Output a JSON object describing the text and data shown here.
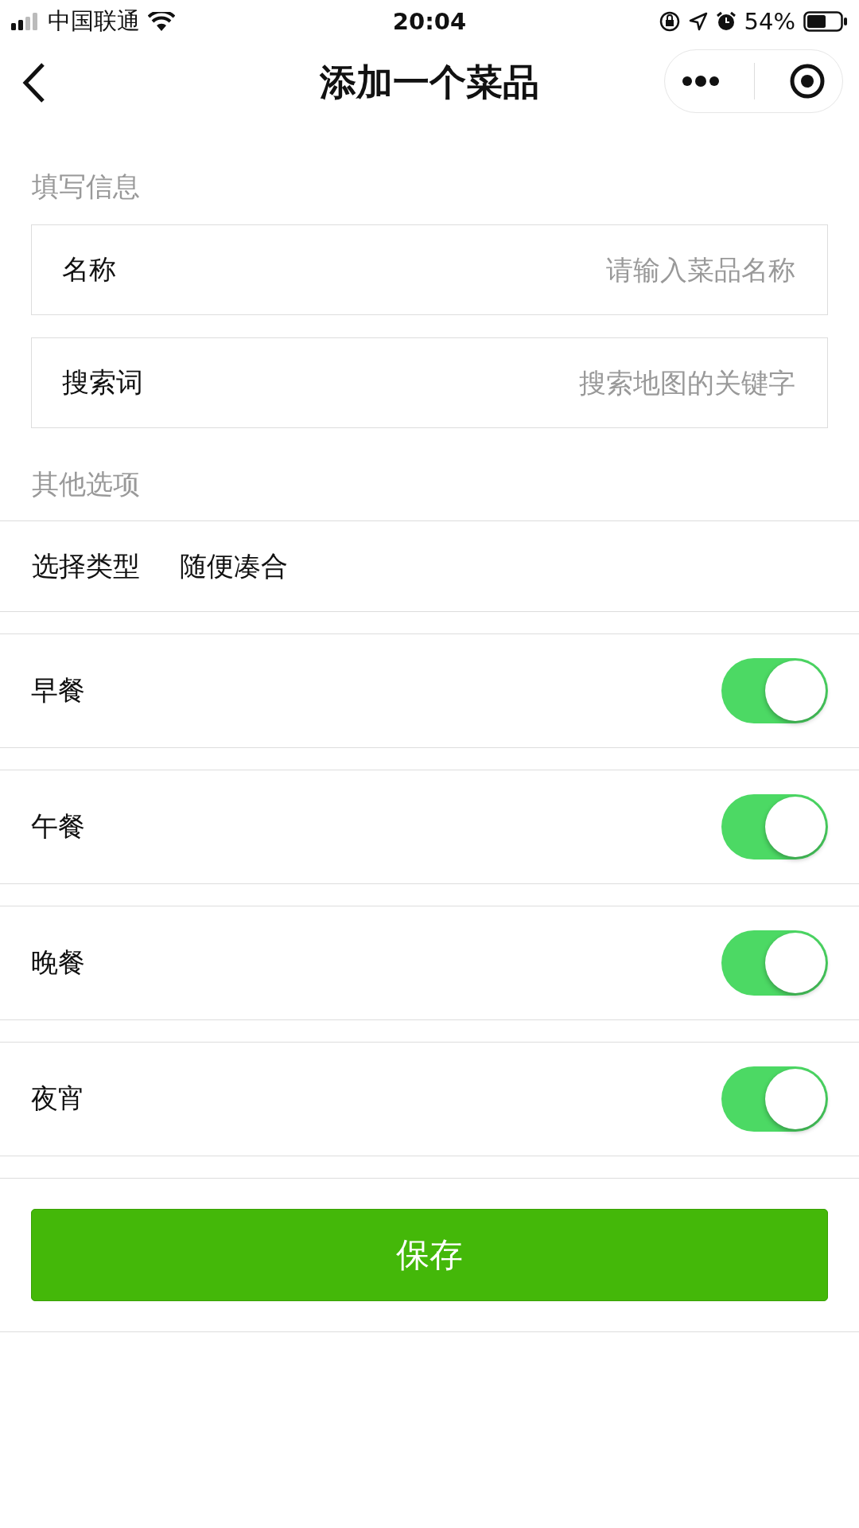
{
  "status_bar": {
    "carrier": "中国联通",
    "time": "20:04",
    "battery": "54%"
  },
  "nav_bar": {
    "title": "添加一个菜品"
  },
  "info_section": {
    "label": "填写信息",
    "fields": [
      {
        "label": "名称",
        "placeholder": "请输入菜品名称"
      },
      {
        "label": "搜索词",
        "placeholder": "搜索地图的关键字"
      }
    ]
  },
  "options_section": {
    "label": "其他选项",
    "type_row": {
      "label": "选择类型",
      "value": "随便凑合"
    },
    "meals": [
      {
        "label": "早餐",
        "on": true
      },
      {
        "label": "午餐",
        "on": true
      },
      {
        "label": "晚餐",
        "on": true
      },
      {
        "label": "夜宵",
        "on": true
      }
    ]
  },
  "save_button": "保存"
}
